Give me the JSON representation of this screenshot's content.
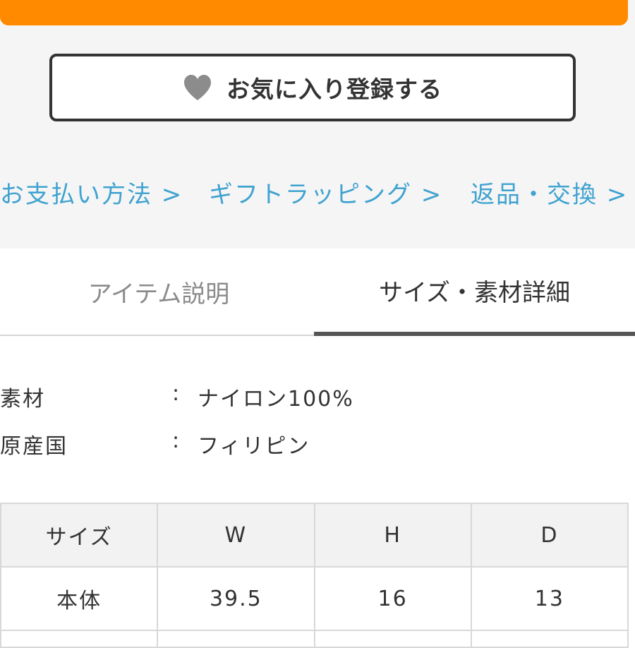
{
  "colors": {
    "accent": "#ff8a00",
    "link": "#3fa2d0",
    "heart": "#8c8c8c"
  },
  "favorite_button": {
    "label": "お気に入り登録する",
    "icon": "heart-icon"
  },
  "links": [
    {
      "label": "お支払い方法 >"
    },
    {
      "label": "ギフトラッピング >"
    },
    {
      "label": "返品・交換 >"
    }
  ],
  "tabs": [
    {
      "label": "アイテム説明",
      "active": false
    },
    {
      "label": "サイズ・素材詳細",
      "active": true
    }
  ],
  "specs": [
    {
      "key": "素材",
      "colon": ":",
      "value": "ナイロン100%"
    },
    {
      "key": "原産国",
      "colon": ":",
      "value": "フィリピン"
    }
  ],
  "size_table": {
    "headers": [
      "サイズ",
      "W",
      "H",
      "D"
    ],
    "rows": [
      [
        "本体",
        "39.5",
        "16",
        "13"
      ]
    ]
  }
}
